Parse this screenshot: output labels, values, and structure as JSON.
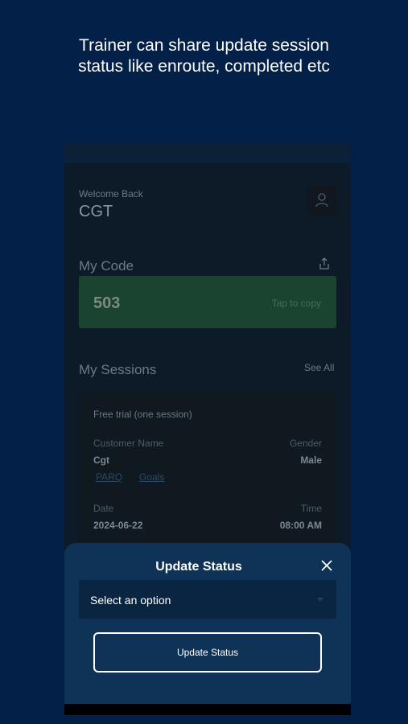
{
  "caption": {
    "line1": "Trainer can share update session",
    "line2": "status like enroute, completed etc"
  },
  "header": {
    "welcome": "Welcome Back",
    "username": "CGT",
    "avatar_icon": "user-icon"
  },
  "my_code": {
    "title": "My Code",
    "share_icon": "share-icon",
    "code": "503",
    "tap_label": "Tap to copy"
  },
  "sessions": {
    "title": "My Sessions",
    "see_all": "See All",
    "card": {
      "type": "Free trial (one session)",
      "customer_label": "Customer Name",
      "customer_value": "Cgt",
      "gender_label": "Gender",
      "gender_value": "Male",
      "link_parq": "PARQ",
      "link_goals": "Goals",
      "date_label": "Date",
      "date_value": "2024-06-22",
      "time_label": "Time",
      "time_value": "08:00 AM"
    }
  },
  "modal": {
    "title": "Update Status",
    "close_icon": "close-icon",
    "select_placeholder": "Select an option",
    "button_label": "Update Status"
  },
  "colors": {
    "background": "#022048",
    "sheet": "#0f3356",
    "code_card": "#1a4430"
  }
}
